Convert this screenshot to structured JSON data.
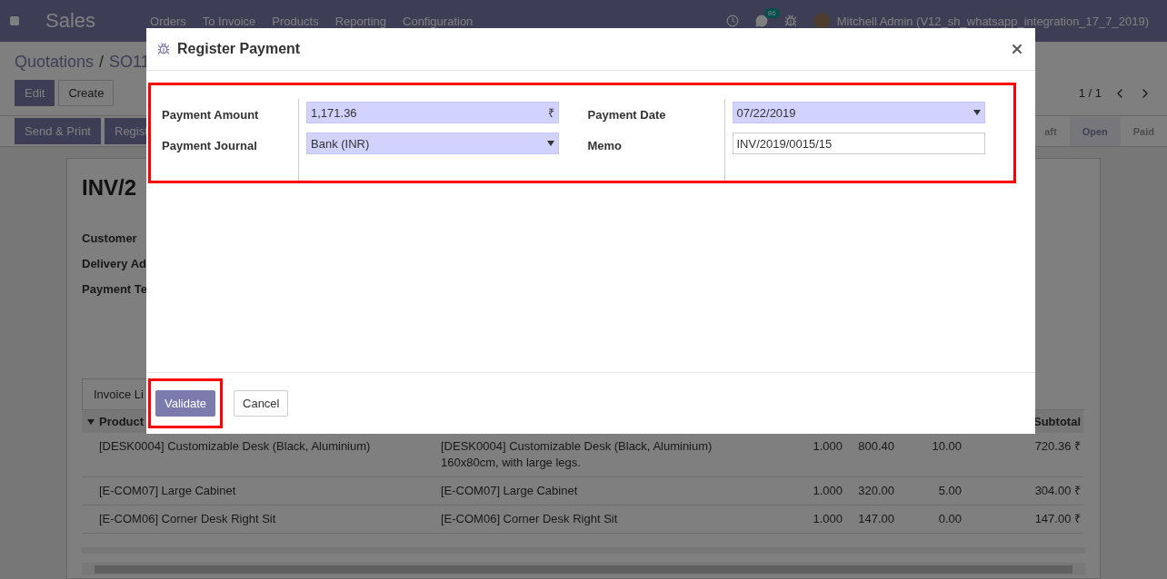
{
  "navbar": {
    "app": "Sales",
    "menu": [
      "Orders",
      "To Invoice",
      "Products",
      "Reporting",
      "Configuration"
    ],
    "messages_count": "86",
    "user": "Mitchell Admin (V12_sh_whatsapp_integration_17_7_2019)"
  },
  "breadcrumb": {
    "parent": "Quotations",
    "separator": "/",
    "current": "SO11"
  },
  "actions": [
    "Edit",
    "Create"
  ],
  "pager": "1 / 1",
  "header_buttons": [
    "Send & Print",
    "Regist"
  ],
  "stages": [
    {
      "label": "aft",
      "selected": false
    },
    {
      "label": "Open",
      "selected": true
    },
    {
      "label": "Paid",
      "selected": false
    }
  ],
  "sheet": {
    "title": "INV/2",
    "fields": [
      "Customer",
      "Delivery Ad",
      "Payment Te"
    ],
    "tab": "Invoice Li"
  },
  "table": {
    "columns": [
      "Product",
      "Subtotal"
    ],
    "rows": [
      {
        "product": "[DESK0004] Customizable Desk (Black, Aluminium)",
        "column_2": "[DESK0004] Customizable Desk (Black, Aluminium) 160x80cm, with large legs.",
        "column_3": "1.000",
        "column_4": "800.40",
        "column_5": "10.00",
        "subtotal": "720.36 ₹"
      },
      {
        "product": "[E-COM07] Large Cabinet",
        "column_2": "[E-COM07] Large Cabinet",
        "column_3": "1.000",
        "column_4": "320.00",
        "column_5": "5.00",
        "subtotal": "304.00 ₹"
      },
      {
        "product": "[E-COM06] Corner Desk Right Sit",
        "column_2": "[E-COM06] Corner Desk Right Sit",
        "column_3": "1.000",
        "column_4": "147.00",
        "column_5": "0.00",
        "subtotal": "147.00 ₹"
      }
    ]
  },
  "dialog": {
    "title": "Register Payment",
    "form_highlighted": true,
    "left_fields": [
      {
        "kind": "amount",
        "label": "Payment Amount",
        "value": "1,171.36",
        "suffix": "₹",
        "required": true
      },
      {
        "kind": "select",
        "label": "Payment Journal",
        "value": "Bank (INR)",
        "required": true
      }
    ],
    "right_fields": [
      {
        "kind": "date",
        "label": "Payment Date",
        "value": "07/22/2019",
        "required": true
      },
      {
        "kind": "text",
        "label": "Memo",
        "value": "INV/2019/0015/15",
        "required": false
      }
    ],
    "buttons": [
      {
        "kind": "primary",
        "label": "Validate",
        "highlighted": true
      },
      {
        "kind": "secondary",
        "label": "Cancel",
        "highlighted": false
      }
    ]
  }
}
